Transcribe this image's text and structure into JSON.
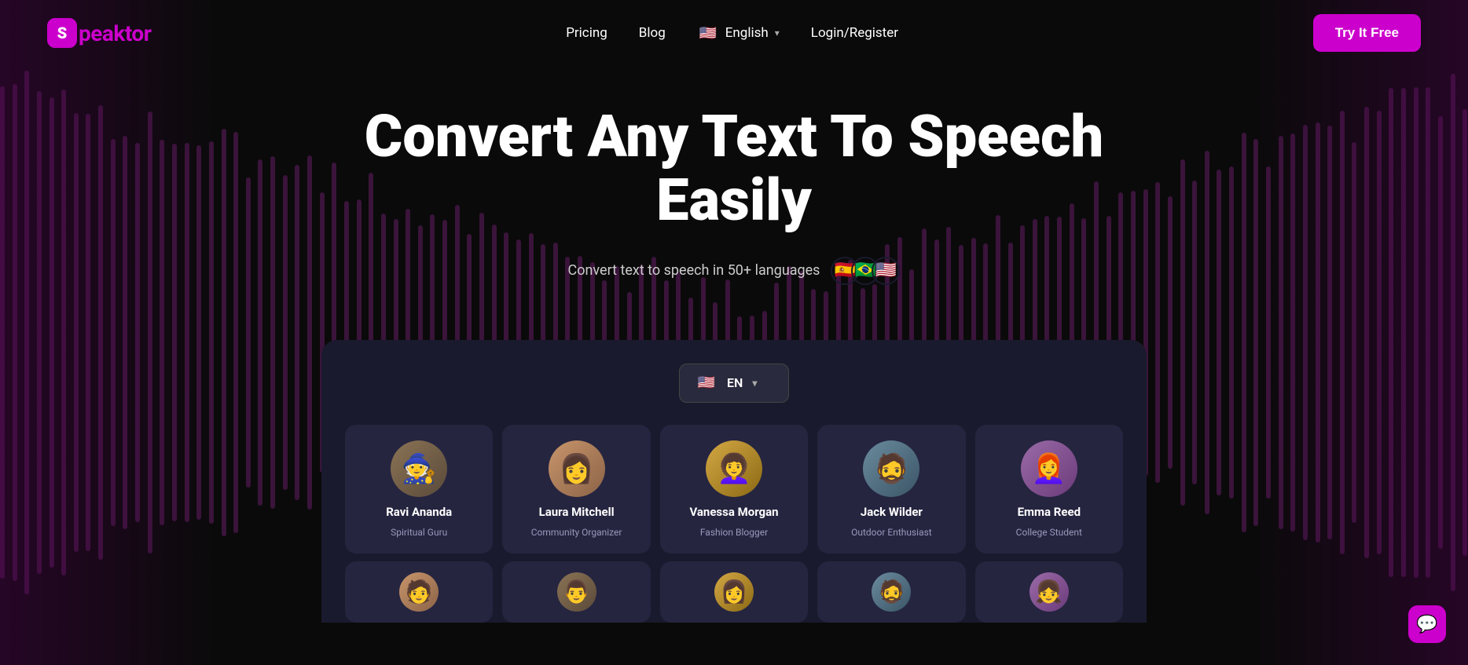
{
  "nav": {
    "logo_letter": "S",
    "logo_name_prefix": "",
    "logo_name": "peaktor",
    "pricing_label": "Pricing",
    "blog_label": "Blog",
    "lang_label": "English",
    "login_label": "Login/Register",
    "try_label": "Try It Free"
  },
  "hero": {
    "headline": "Convert Any Text To Speech Easily",
    "subtitle": "Convert text to speech in 50+ languages"
  },
  "app": {
    "lang_code": "EN",
    "voices": [
      {
        "id": "ravi",
        "name": "Ravi Ananda",
        "role": "Spiritual Guru",
        "avatar_class": "avatar-ravi",
        "emoji": "🧙"
      },
      {
        "id": "laura",
        "name": "Laura Mitchell",
        "role": "Community Organizer",
        "avatar_class": "avatar-laura",
        "emoji": "👩"
      },
      {
        "id": "vanessa",
        "name": "Vanessa Morgan",
        "role": "Fashion Blogger",
        "avatar_class": "avatar-vanessa",
        "emoji": "👩‍🦱"
      },
      {
        "id": "jack",
        "name": "Jack Wilder",
        "role": "Outdoor Enthusiast",
        "avatar_class": "avatar-jack",
        "emoji": "🧔"
      },
      {
        "id": "emma",
        "name": "Emma Reed",
        "role": "College Student",
        "avatar_class": "avatar-emma",
        "emoji": "👩‍🦰"
      }
    ],
    "voices_row2": [
      {
        "id": "r2a",
        "avatar_class": "avatar-laura",
        "emoji": "🧑"
      },
      {
        "id": "r2b",
        "avatar_class": "avatar-ravi",
        "emoji": "👨"
      },
      {
        "id": "r2c",
        "avatar_class": "avatar-vanessa",
        "emoji": "👩"
      },
      {
        "id": "r2d",
        "avatar_class": "avatar-jack",
        "emoji": "🧔"
      },
      {
        "id": "r2e",
        "avatar_class": "avatar-emma",
        "emoji": "👧"
      }
    ]
  },
  "chat": {
    "icon": "💬"
  },
  "flags": {
    "spain": "🇪🇸",
    "brazil": "🇧🇷",
    "usa": "🇺🇸"
  }
}
